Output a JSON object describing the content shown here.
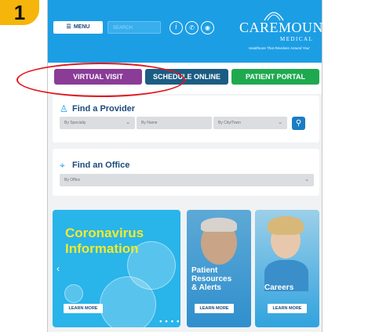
{
  "step": "1",
  "header": {
    "menu_label": "MENU",
    "search_placeholder": "SEARCH",
    "logo": "CAREMOUNT",
    "logo_sub": "MEDICAL",
    "tagline": "Healthcare That Revolves Around You!"
  },
  "actions": {
    "virtual_visit": "VIRTUAL VISIT",
    "schedule_online": "SCHEDULE ONLINE",
    "patient_portal": "PATIENT PORTAL"
  },
  "find_provider": {
    "title": "Find a Provider",
    "specialty": "By Specialty",
    "name": "By Name",
    "city": "By City/Town"
  },
  "find_office": {
    "title": "Find an Office",
    "office": "By Office"
  },
  "tiles": {
    "corona": {
      "title_1": "Coronavirus",
      "title_2": "Information",
      "button": "LEARN MORE"
    },
    "patient": {
      "title_1": "Patient",
      "title_2": "Resources",
      "title_3": "& Alerts",
      "button": "LEARN MORE"
    },
    "careers": {
      "title": "Careers",
      "button": "LEARN MORE"
    }
  },
  "colors": {
    "header": "#1c9ee5",
    "virtual": "#8a3c96",
    "schedule": "#1b5c83",
    "portal": "#1fa94f",
    "highlight": "#e2151a",
    "badge": "#f5b50a"
  }
}
